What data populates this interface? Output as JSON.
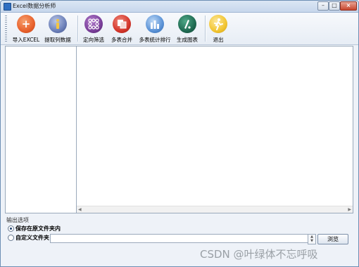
{
  "window": {
    "title": "Excel数据分析师"
  },
  "toolbar": {
    "buttons": [
      {
        "id": "import",
        "label": "导入EXCEL",
        "icon": "plus-icon",
        "color": "#e8612c"
      },
      {
        "id": "extract",
        "label": "提取列数据",
        "icon": "info-icon",
        "color": "#6b7fb8"
      },
      {
        "id": "filter",
        "label": "定向筛选",
        "icon": "dots-grid-icon",
        "color": "#7a3f9a"
      },
      {
        "id": "merge",
        "label": "多表合并",
        "icon": "copy-icon",
        "color": "#d4362b"
      },
      {
        "id": "rank",
        "label": "多表统计排行",
        "icon": "bar-chart-icon",
        "color": "#5a92d6"
      },
      {
        "id": "chart",
        "label": "生成图表",
        "icon": "chart-line-icon",
        "color": "#1f6b52"
      },
      {
        "id": "exit",
        "label": "退出",
        "icon": "runner-icon",
        "color": "#f2c531"
      }
    ]
  },
  "output": {
    "group_label": "输出选项",
    "option_save_original": "保存在原文件夹内",
    "option_custom": "自定义文件夹",
    "path_value": "",
    "browse_label": "浏览"
  },
  "watermark": "CSDN @叶绿体不忘呼吸"
}
